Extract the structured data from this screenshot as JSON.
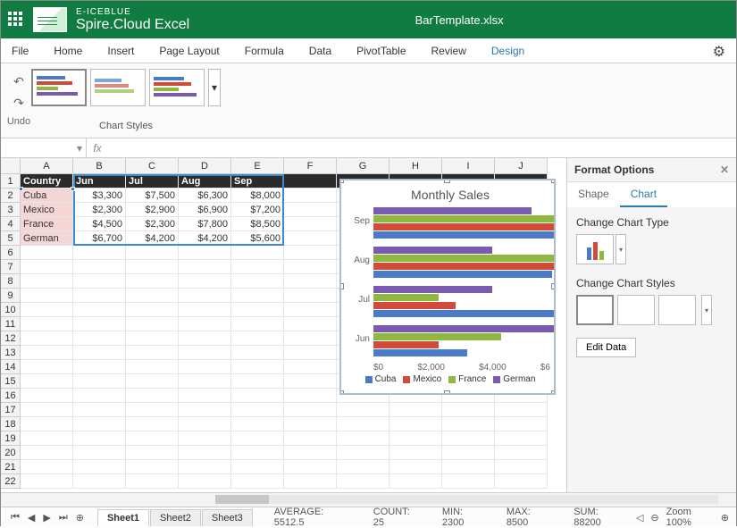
{
  "app": {
    "brand_small": "E-ICEBLUE",
    "brand": "Spire.Cloud Excel",
    "filename": "BarTemplate.xlsx"
  },
  "menu": [
    "File",
    "Home",
    "Insert",
    "Page Layout",
    "Formula",
    "Data",
    "PivotTable",
    "Review",
    "Design"
  ],
  "active_menu": "Design",
  "ribbon": {
    "undo": "Undo",
    "group": "Chart Styles"
  },
  "fx": {
    "label": "fx"
  },
  "columns": [
    "A",
    "B",
    "C",
    "D",
    "E",
    "F",
    "G",
    "H",
    "I",
    "J"
  ],
  "rows": 22,
  "headers": [
    "Country",
    "Jun",
    "Jul",
    "Aug",
    "Sep"
  ],
  "data": [
    [
      "Cuba",
      "$3,300",
      "$7,500",
      "$6,300",
      "$8,000"
    ],
    [
      "Mexico",
      "$2,300",
      "$2,900",
      "$6,900",
      "$7,200"
    ],
    [
      "France",
      "$4,500",
      "$2,300",
      "$7,800",
      "$8,500"
    ],
    [
      "German",
      "$6,700",
      "$4,200",
      "$4,200",
      "$5,600"
    ]
  ],
  "chart_data": {
    "type": "bar",
    "title": "Monthly Sales",
    "categories": [
      "Jun",
      "Jul",
      "Aug",
      "Sep"
    ],
    "series": [
      {
        "name": "Cuba",
        "color": "#4a7bc8",
        "values": [
          3300,
          7500,
          6300,
          8000
        ]
      },
      {
        "name": "Mexico",
        "color": "#d14b3a",
        "values": [
          2300,
          2900,
          6900,
          7200
        ]
      },
      {
        "name": "France",
        "color": "#8fb93e",
        "values": [
          4500,
          2300,
          7800,
          8500
        ]
      },
      {
        "name": "German",
        "color": "#7a5bb0",
        "values": [
          6700,
          4200,
          4200,
          5600
        ]
      }
    ],
    "x_ticks": [
      "$0",
      "$2,000",
      "$4,000",
      "$6"
    ],
    "xlim": [
      0,
      6000
    ]
  },
  "panel": {
    "title": "Format Options",
    "tabs": [
      "Shape",
      "Chart"
    ],
    "active": "Chart",
    "change_type": "Change Chart Type",
    "change_styles": "Change Chart Styles",
    "edit_data": "Edit Data"
  },
  "sheets": [
    "Sheet1",
    "Sheet2",
    "Sheet3"
  ],
  "status": {
    "average": "AVERAGE: 5512.5",
    "count": "COUNT: 25",
    "min": "MIN: 2300",
    "max": "MAX: 8500",
    "sum": "SUM: 88200",
    "zoom": "Zoom 100%"
  }
}
